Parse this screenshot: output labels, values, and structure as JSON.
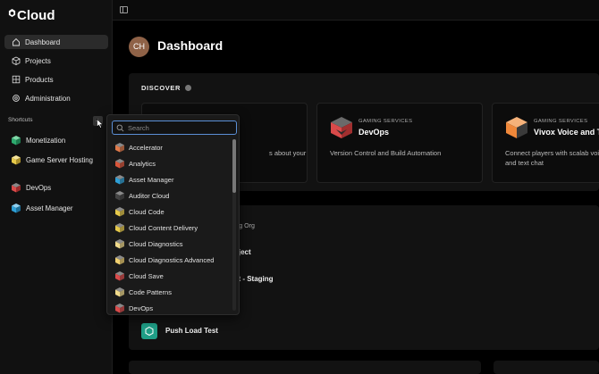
{
  "app": {
    "logo_text": "Cloud"
  },
  "sidebar": {
    "items": [
      {
        "label": "Dashboard",
        "icon": "home-icon",
        "active": true
      },
      {
        "label": "Projects",
        "icon": "cube-outline-icon"
      },
      {
        "label": "Products",
        "icon": "grid-icon"
      },
      {
        "label": "Administration",
        "icon": "gear-icon"
      }
    ],
    "shortcuts_label": "Shortcuts",
    "shortcuts_add": "+",
    "shortcuts": [
      {
        "label": "Monetization",
        "color": "#2eaa6e"
      },
      {
        "label": "Game Server Hosting",
        "color": "#e6c94a"
      },
      {
        "label": "DevOps",
        "color": "#d94a4a"
      },
      {
        "label": "Asset Manager",
        "color": "#2e9fd6"
      }
    ]
  },
  "main": {
    "avatar_initials": "CH",
    "title": "Dashboard",
    "discover": {
      "title": "DISCOVER",
      "cards": [
        {
          "category": "",
          "name": "",
          "desc": "s about your"
        },
        {
          "category": "GAMING SERVICES",
          "name": "DevOps",
          "desc": "Version Control and Build Automation",
          "color": "#d94a4a"
        },
        {
          "category": "GAMING SERVICES",
          "name": "Vivox Voice and T",
          "desc": "Connect players with scalab voice and text chat",
          "color": "#f0883a"
        }
      ]
    },
    "projects": {
      "org_label": "ging Org",
      "rows": [
        "oject",
        "ct - Staging"
      ],
      "push_label": "Push Load Test"
    }
  },
  "dropdown": {
    "search_placeholder": "Search",
    "items": [
      {
        "label": "Accelerator",
        "color": "#e07a4a"
      },
      {
        "label": "Analytics",
        "color": "#d9553a"
      },
      {
        "label": "Asset Manager",
        "color": "#2e9fd6"
      },
      {
        "label": "Auditor Cloud",
        "color": "#444444"
      },
      {
        "label": "Cloud Code",
        "color": "#e6c94a"
      },
      {
        "label": "Cloud Content Delivery",
        "color": "#e6c94a"
      },
      {
        "label": "Cloud Diagnostics",
        "color": "#f0d98a"
      },
      {
        "label": "Cloud Diagnostics Advanced",
        "color": "#f0d070"
      },
      {
        "label": "Cloud Save",
        "color": "#d94a4a"
      },
      {
        "label": "Code Patterns",
        "color": "#f0d98a"
      },
      {
        "label": "DevOps",
        "color": "#d94a4a"
      }
    ]
  }
}
